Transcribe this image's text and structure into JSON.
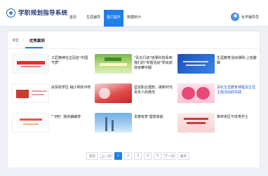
{
  "header": {
    "app_title": "学职规划指导系统",
    "nav": [
      {
        "label": "首页",
        "active": false
      },
      {
        "label": "生涯辅导",
        "active": false
      },
      {
        "label": "指力提升",
        "active": true
      },
      {
        "label": "数据统计",
        "active": false
      }
    ],
    "user_name": "化学辅导员"
  },
  "breadcrumb": {
    "home": "课堂",
    "separator": "/",
    "current": "优秀案例"
  },
  "cases": [
    {
      "title": "工匠精神在古冠名\"中国气质\""
    },
    {
      "title": "\"青鸟行动\"结果科技系到我们的\"专题活动\"项目成效考察中期"
    },
    {
      "title": "生涯教育活动课例-上班瓣峰"
    },
    {
      "title": "扶贫助学区-缩小明年中阶"
    },
    {
      "title": "坚定职业理想，做新时代青年人的典范"
    },
    {
      "title": "深化生涯教育课程及生涯主题活动的实践"
    },
    {
      "title": "\"飞吧！我的翩翩梦"
    },
    {
      "title": "青春有梦 理想启航"
    },
    {
      "title": "革命老区与体育护士"
    }
  ],
  "pagination": {
    "first": "首页",
    "prev": "上一页",
    "pages": [
      "1",
      "2",
      "3",
      "4",
      "5"
    ],
    "current": "1",
    "next": "下一页",
    "last": "尾页"
  },
  "colors": {
    "accent": "#1f7fe8",
    "title": "#1e3a78"
  }
}
